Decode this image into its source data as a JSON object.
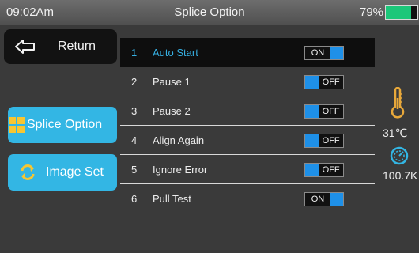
{
  "status": {
    "time": "09:02Am",
    "title": "Splice Option",
    "battery": "79%",
    "battery_level": 0.79
  },
  "sidebar": {
    "return_label": "Return",
    "splice_option_label": "Splice Option",
    "image_set_label": "Image Set"
  },
  "options": [
    {
      "num": "1",
      "label": "Auto Start",
      "state": "ON"
    },
    {
      "num": "2",
      "label": "Pause 1",
      "state": "OFF"
    },
    {
      "num": "3",
      "label": "Pause 2",
      "state": "OFF"
    },
    {
      "num": "4",
      "label": "Align Again",
      "state": "OFF"
    },
    {
      "num": "5",
      "label": "Ignore Error",
      "state": "OFF"
    },
    {
      "num": "6",
      "label": "Pull Test",
      "state": "ON"
    }
  ],
  "readouts": {
    "temperature": "31℃",
    "pressure": "100.7K"
  },
  "colors": {
    "accent": "#33b6e4",
    "toggle_fill": "#1e90e8",
    "battery": "#1cc77a"
  },
  "icons": {
    "return": "arrow-left-icon",
    "splice": "grid-icon",
    "image": "refresh-icon",
    "temperature": "thermometer-icon",
    "pressure": "gauge-icon"
  }
}
